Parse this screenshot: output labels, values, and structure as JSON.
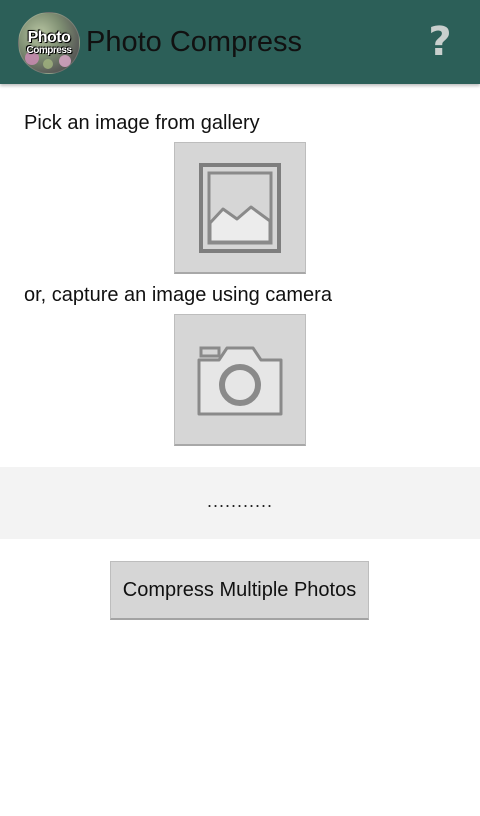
{
  "action_bar": {
    "logo_text_line1": "Photo",
    "logo_text_line2": "Compress",
    "title": "Photo Compress",
    "help_label": "?",
    "background_color": "#2c5f58"
  },
  "gallery": {
    "label": "Pick an image from gallery",
    "icon": "image-gallery-icon"
  },
  "camera": {
    "label": "or, capture an image using camera",
    "icon": "camera-icon"
  },
  "status": {
    "text": "..........."
  },
  "compress_multiple": {
    "label": "Compress Multiple Photos"
  }
}
